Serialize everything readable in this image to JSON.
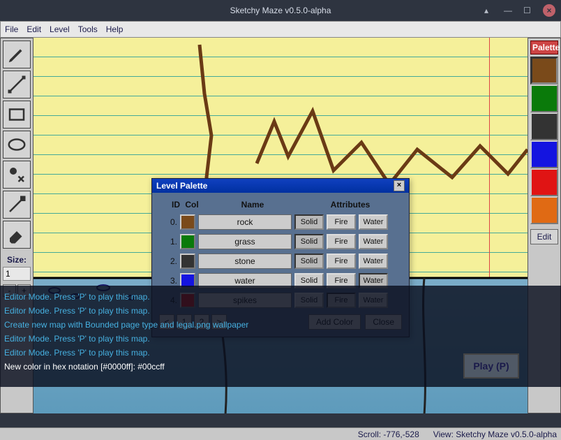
{
  "window": {
    "title": "Sketchy Maze v0.5.0-alpha"
  },
  "menu": {
    "items": [
      "File",
      "Edit",
      "Level",
      "Tools",
      "Help"
    ]
  },
  "toolbar": {
    "size_label": "Size:",
    "size_value": "1",
    "minus": "-",
    "plus": "+"
  },
  "palette": {
    "header": "Palette",
    "swatches": [
      {
        "color": "#7a4a1a",
        "selected": true
      },
      {
        "color": "#0a7a0a"
      },
      {
        "color": "#333333"
      },
      {
        "color": "#1414e0"
      },
      {
        "color": "#e01414"
      },
      {
        "color": "#e06a14"
      }
    ],
    "edit_label": "Edit"
  },
  "dialog": {
    "title": "Level Palette",
    "cols": {
      "id": "ID",
      "col": "Col",
      "name": "Name",
      "attr": "Attributes"
    },
    "rows": [
      {
        "id": "0.",
        "color": "#7a4a1a",
        "name": "rock",
        "solid": true,
        "fire": false,
        "water": false
      },
      {
        "id": "1.",
        "color": "#0a7a0a",
        "name": "grass",
        "solid": true,
        "fire": false,
        "water": false
      },
      {
        "id": "2.",
        "color": "#333333",
        "name": "stone",
        "solid": true,
        "fire": false,
        "water": false
      },
      {
        "id": "3.",
        "color": "#1414e0",
        "name": "water",
        "solid": false,
        "fire": false,
        "water": true
      },
      {
        "id": "4.",
        "color": "#e01414",
        "name": "spikes",
        "solid": false,
        "fire": true,
        "water": false
      }
    ],
    "attr_labels": {
      "solid": "Solid",
      "fire": "Fire",
      "water": "Water"
    },
    "pager": {
      "prev": "<",
      "p1": "1",
      "p2": "2",
      "next": ">"
    },
    "add": "Add Color",
    "close": "Close"
  },
  "console": {
    "lines": [
      "Editor Mode. Press 'P' to play this map.",
      "Editor Mode. Press 'P' to play this map.",
      "Create new map with Bounded page type and legal.png wallpaper",
      "Editor Mode. Press 'P' to play this map.",
      "Editor Mode. Press 'P' to play this map."
    ],
    "input": "New color in hex notation [#0000ff]: #00ccff"
  },
  "play_btn": "Play (P)",
  "status": {
    "left": "",
    "scroll": "Scroll: -776,-528",
    "view": "View: Sketchy Maze v0.5.0-alpha"
  }
}
